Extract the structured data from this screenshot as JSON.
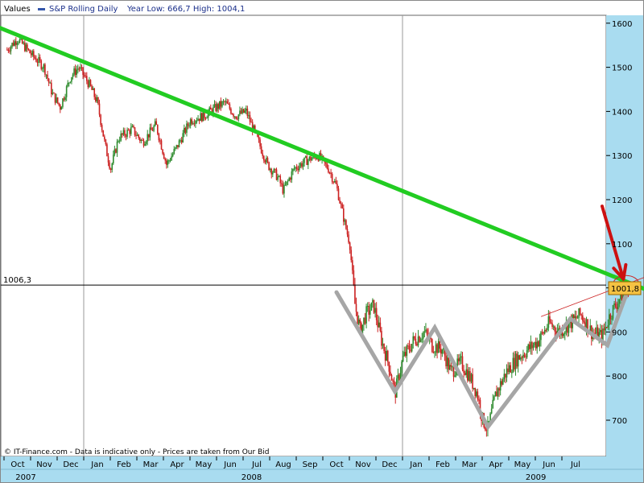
{
  "header": {
    "values_label": "Values",
    "series_label": "S&P Rolling Daily",
    "year_stats": "Year Low: 666,7 High: 1004,1"
  },
  "footer": {
    "copyright": "© IT-Finance.com - Data is indicative only - Prices are taken from Our Bid"
  },
  "colors": {
    "background": "#ffffff",
    "axis_panel": "#a9dcf0",
    "up_candle": "#2e8b2e",
    "down_candle": "#cc2222",
    "trendline": "#22cc22",
    "pattern": "#a6a6a6",
    "arrow": "#cc1111",
    "price_badge": "#f5c242",
    "series_marker": "#3355aa"
  },
  "chart_data": {
    "type": "candlestick",
    "title": "S&P Rolling Daily",
    "ylabel": "",
    "xlabel": "",
    "ylim": [
      630,
      1630
    ],
    "y_ticks": [
      700,
      800,
      900,
      1000,
      1100,
      1200,
      1300,
      1400,
      1500,
      1600
    ],
    "y_tick_labels": [
      "700",
      "800",
      "900",
      "1000",
      "1100",
      "1200",
      "1300",
      "1400",
      "1500",
      "1600"
    ],
    "x_months": [
      "Oct",
      "Nov",
      "Dec",
      "Jan",
      "Feb",
      "Mar",
      "Apr",
      "May",
      "Jun",
      "Jul",
      "Aug",
      "Sep",
      "Oct",
      "Nov",
      "Dec",
      "Jan",
      "Feb",
      "Mar",
      "Apr",
      "May",
      "Jun",
      "Jul"
    ],
    "x_years": [
      {
        "label": "2007",
        "month_index": 0
      },
      {
        "label": "2008",
        "month_index": 8.5
      },
      {
        "label": "2009",
        "month_index": 19.2
      }
    ],
    "year_separators_month_index": [
      3,
      15
    ],
    "price_path": [
      {
        "m": -0.4,
        "p": 1540
      },
      {
        "m": 0.0,
        "p": 1565
      },
      {
        "m": 0.5,
        "p": 1530
      },
      {
        "m": 1.0,
        "p": 1500
      },
      {
        "m": 1.3,
        "p": 1440
      },
      {
        "m": 1.6,
        "p": 1410
      },
      {
        "m": 2.0,
        "p": 1480
      },
      {
        "m": 2.3,
        "p": 1500
      },
      {
        "m": 2.7,
        "p": 1460
      },
      {
        "m": 3.0,
        "p": 1420
      },
      {
        "m": 3.3,
        "p": 1320
      },
      {
        "m": 3.5,
        "p": 1270
      },
      {
        "m": 3.8,
        "p": 1340
      },
      {
        "m": 4.3,
        "p": 1360
      },
      {
        "m": 4.7,
        "p": 1330
      },
      {
        "m": 5.2,
        "p": 1370
      },
      {
        "m": 5.6,
        "p": 1280
      },
      {
        "m": 6.0,
        "p": 1320
      },
      {
        "m": 6.5,
        "p": 1380
      },
      {
        "m": 7.0,
        "p": 1390
      },
      {
        "m": 7.5,
        "p": 1410
      },
      {
        "m": 7.8,
        "p": 1420
      },
      {
        "m": 8.2,
        "p": 1390
      },
      {
        "m": 8.6,
        "p": 1400
      },
      {
        "m": 9.0,
        "p": 1340
      },
      {
        "m": 9.4,
        "p": 1280
      },
      {
        "m": 9.8,
        "p": 1250
      },
      {
        "m": 10.0,
        "p": 1220
      },
      {
        "m": 10.4,
        "p": 1270
      },
      {
        "m": 10.9,
        "p": 1290
      },
      {
        "m": 11.3,
        "p": 1300
      },
      {
        "m": 11.7,
        "p": 1270
      },
      {
        "m": 12.0,
        "p": 1230
      },
      {
        "m": 12.3,
        "p": 1150
      },
      {
        "m": 12.5,
        "p": 1100
      },
      {
        "m": 12.7,
        "p": 960
      },
      {
        "m": 12.9,
        "p": 900
      },
      {
        "m": 13.1,
        "p": 940
      },
      {
        "m": 13.4,
        "p": 960
      },
      {
        "m": 13.7,
        "p": 880
      },
      {
        "m": 14.0,
        "p": 820
      },
      {
        "m": 14.2,
        "p": 760
      },
      {
        "m": 14.5,
        "p": 840
      },
      {
        "m": 14.9,
        "p": 880
      },
      {
        "m": 15.3,
        "p": 900
      },
      {
        "m": 15.6,
        "p": 870
      },
      {
        "m": 16.0,
        "p": 860
      },
      {
        "m": 16.3,
        "p": 810
      },
      {
        "m": 16.7,
        "p": 830
      },
      {
        "m": 17.0,
        "p": 800
      },
      {
        "m": 17.3,
        "p": 760
      },
      {
        "m": 17.5,
        "p": 700
      },
      {
        "m": 17.7,
        "p": 680
      },
      {
        "m": 18.0,
        "p": 760
      },
      {
        "m": 18.4,
        "p": 810
      },
      {
        "m": 18.8,
        "p": 840
      },
      {
        "m": 19.2,
        "p": 860
      },
      {
        "m": 19.6,
        "p": 880
      },
      {
        "m": 20.0,
        "p": 920
      },
      {
        "m": 20.4,
        "p": 900
      },
      {
        "m": 20.8,
        "p": 920
      },
      {
        "m": 21.2,
        "p": 940
      },
      {
        "m": 21.6,
        "p": 900
      },
      {
        "m": 22.0,
        "p": 890
      },
      {
        "m": 22.3,
        "p": 940
      },
      {
        "m": 22.7,
        "p": 980
      },
      {
        "m": 23.0,
        "p": 1000
      }
    ],
    "trendline": [
      {
        "m": -0.7,
        "p": 1590
      },
      {
        "m": 23.9,
        "p": 990
      }
    ],
    "pattern_line": [
      {
        "m": 12.0,
        "p": 990
      },
      {
        "m": 14.2,
        "p": 765
      },
      {
        "m": 15.7,
        "p": 910
      },
      {
        "m": 17.7,
        "p": 685
      },
      {
        "m": 20.8,
        "p": 930
      },
      {
        "m": 22.2,
        "p": 870
      },
      {
        "m": 23.0,
        "p": 1000
      }
    ],
    "resistance_line": [
      {
        "m": 19.7,
        "p": 935
      },
      {
        "m": 24.3,
        "p": 1040
      }
    ],
    "reference_level": {
      "value": 1006.3,
      "label": "1006,3"
    },
    "last_price": {
      "value": 1001.8,
      "label": "1001,8"
    },
    "arrow": {
      "from": {
        "m": 22.0,
        "p": 1185
      },
      "to": {
        "m": 22.8,
        "p": 1020
      }
    },
    "circle_marker": {
      "m": 22.9,
      "p": 1008
    }
  }
}
